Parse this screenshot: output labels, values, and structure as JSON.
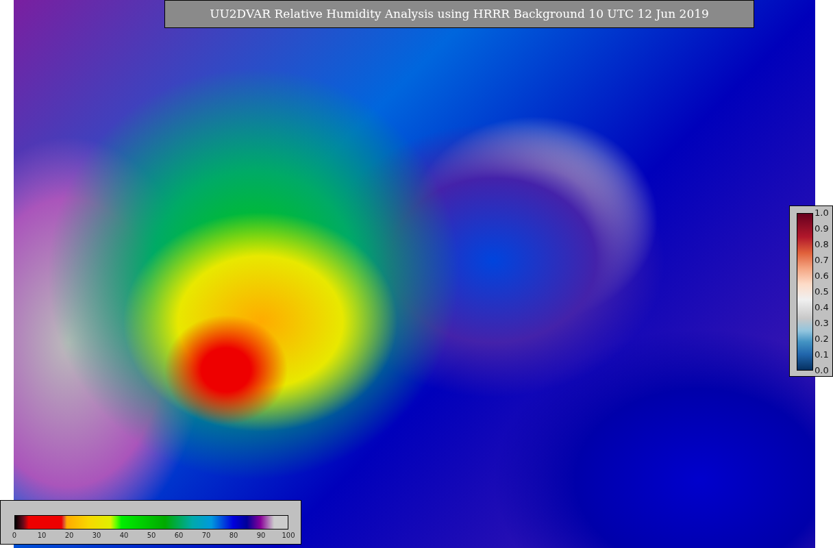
{
  "title": "UU2DVAR Relative Humidity Analysis using HRRR Background 10 UTC 12 Jun 2019",
  "humidity_colorbar": {
    "ticks": [
      "0",
      "10",
      "20",
      "30",
      "40",
      "50",
      "60",
      "70",
      "80",
      "90",
      "100"
    ]
  },
  "station_colorbar": {
    "ticks": [
      "1.0",
      "0.9",
      "0.8",
      "0.7",
      "0.6",
      "0.5",
      "0.4",
      "0.3",
      "0.2",
      "0.1",
      "0.0"
    ]
  }
}
